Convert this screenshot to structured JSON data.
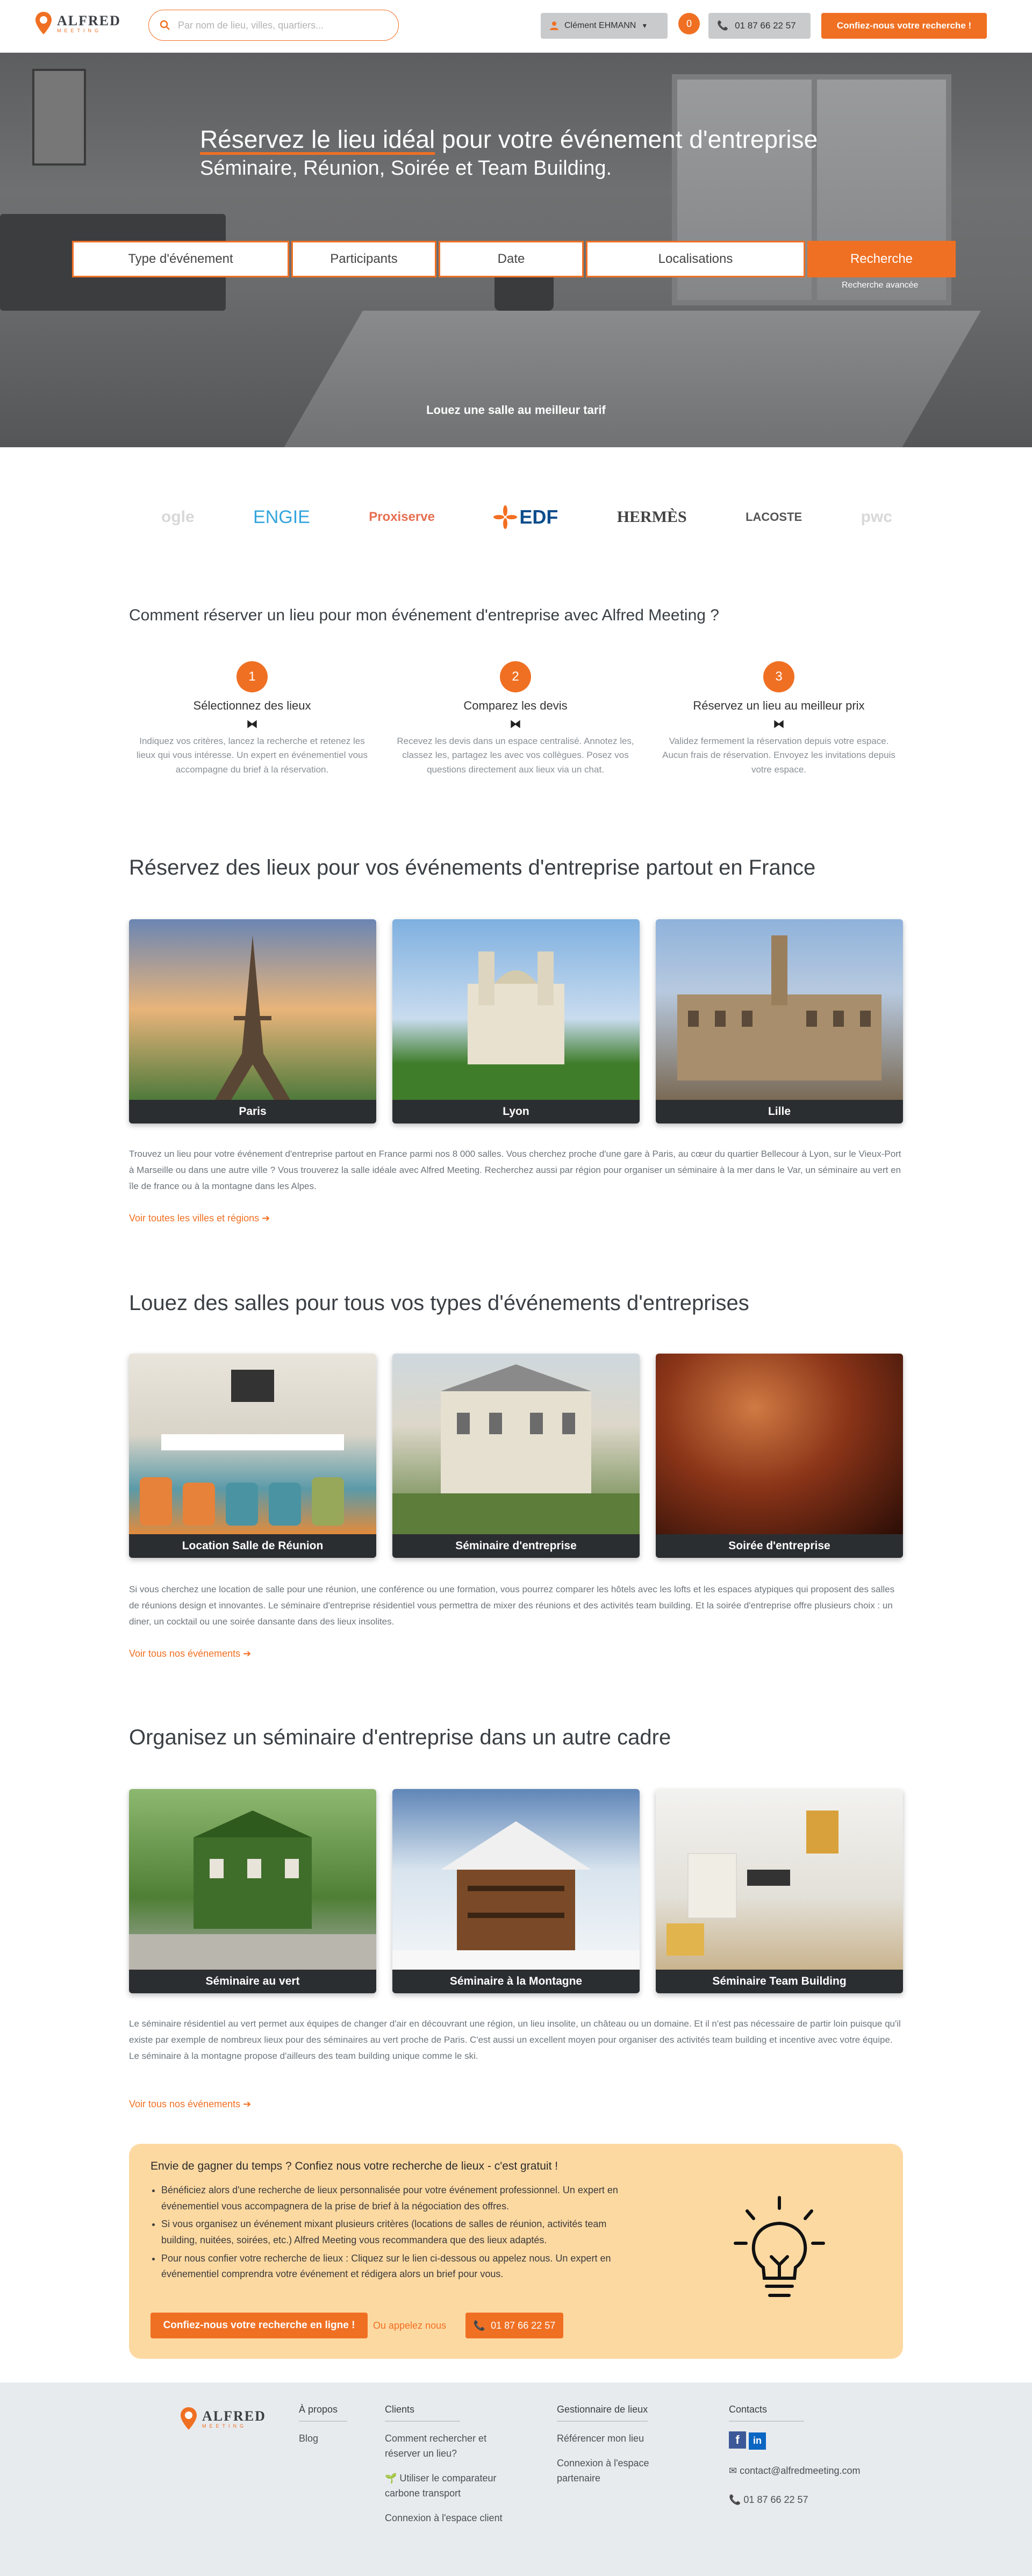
{
  "header": {
    "logo_name": "ALFRED",
    "logo_sub": "MEETING",
    "search_placeholder": "Par nom de lieu, villes, quartiers...",
    "user_name": "Clément EHMANN",
    "notifications": "0",
    "phone": "01 87 66 22 57",
    "cta": "Confiez-nous votre recherche !"
  },
  "hero": {
    "title_highlight": "Réservez le lieu idéal",
    "title_rest": " pour votre événement d'entreprise",
    "subtitle": "Séminaire, Réunion, Soirée et Team Building.",
    "fields": [
      "Type d'événement",
      "Participants",
      "Date",
      "Localisations"
    ],
    "search_button": "Recherche",
    "advanced": "Recherche avancée",
    "tagline": "Louez une salle au meilleur tarif"
  },
  "logos": [
    "ogle",
    "ENGIE",
    "Proxiserve",
    "EDF",
    "HERMÈS",
    "LACOSTE",
    "pwc"
  ],
  "how": {
    "title": "Comment réserver un lieu pour mon événement d'entreprise avec Alfred Meeting ?",
    "steps": [
      {
        "num": "1",
        "title": "Sélectionnez des lieux",
        "desc": "Indiquez vos critères, lancez la recherche et retenez les lieux qui vous intéresse. Un expert en événementiel vous accompagne du brief à la réservation."
      },
      {
        "num": "2",
        "title": "Comparez les devis",
        "desc": "Recevez les devis dans un espace centralisé. Annotez les, classez les, partagez les avec vos collègues. Posez vos questions directement aux lieux via un chat."
      },
      {
        "num": "3",
        "title": "Réservez un lieu au meilleur prix",
        "desc": "Validez fermement la réservation depuis votre espace. Aucun frais de réservation. Envoyez les invitations depuis votre espace."
      }
    ]
  },
  "sections": {
    "cities": {
      "title": "Réservez des lieux pour vos événements d'entreprise partout en France",
      "cards": [
        "Paris",
        "Lyon",
        "Lille"
      ],
      "text": "Trouvez un lieu pour votre événement d'entreprise partout en France parmi nos 8 000 salles. Vous cherchez proche d'une gare à Paris, au cœur du quartier Bellecour à Lyon, sur le Vieux-Port à Marseille ou dans une autre ville ? Vous trouverez la salle idéale avec Alfred Meeting. Recherchez aussi par région pour organiser un séminaire à la mer dans le Var, un séminaire au vert en île de france ou à la montagne dans les Alpes.",
      "link": "Voir toutes les villes et régions ➔"
    },
    "types": {
      "title": "Louez des salles pour tous vos types d'événements d'entreprises",
      "cards": [
        "Location Salle de Réunion",
        "Séminaire d'entreprise",
        "Soirée d'entreprise"
      ],
      "text": "Si vous cherchez une location de salle pour une réunion, une conférence ou une formation, vous pourrez comparer les hôtels avec les lofts et les espaces atypiques qui proposent des salles de réunions design et innovantes. Le séminaire d'entreprise résidentiel vous permettra de mixer des réunions et des activités team building. Et la soirée d'entreprise offre plusieurs choix : un diner, un cocktail ou une soirée dansante dans des lieux insolites.",
      "link": "Voir tous nos événements ➔"
    },
    "cadre": {
      "title": "Organisez un séminaire d'entreprise dans un autre cadre",
      "cards": [
        "Séminaire au vert",
        "Séminaire à la Montagne",
        "Séminaire Team Building"
      ],
      "text": "Le séminaire résidentiel au vert permet aux équipes de changer d'air en découvrant une région, un lieu insolite, un château ou un domaine. Et il n'est pas nécessaire de partir loin puisque qu'il existe par exemple de nombreux lieux pour des séminaires au vert proche de Paris. C'est aussi un excellent moyen pour organiser des activités team building et incentive avec votre équipe. Le séminaire à la montagne propose d'ailleurs des team building unique comme le ski.",
      "link": "Voir tous nos événements ➔"
    }
  },
  "banner": {
    "title": "Envie de gagner du temps ? Confiez nous votre recherche de lieux - c'est gratuit !",
    "bullets": [
      "Bénéficiez alors d'une recherche de lieux personnalisée pour votre événement professionnel. Un expert en événementiel vous accompagnera de la prise de brief à la négociation des offres.",
      "Si vous organisez un événement mixant plusieurs critères (locations de salles de réunion, activités team building, nuitées, soirées, etc.) Alfred Meeting vous recommandera que des lieux adaptés.",
      "Pour nous confier votre recherche de lieux : Cliquez sur le lien ci-dessous ou appelez nous. Un expert en événementiel comprendra votre événement et rédigera alors un brief pour vous."
    ],
    "cta": "Confiez-nous votre recherche en ligne !",
    "or": "Ou appelez nous",
    "phone": "01 87 66 22 57"
  },
  "footer": {
    "about": {
      "head": "À propos",
      "links": [
        "Blog"
      ]
    },
    "clients": {
      "head": "Clients",
      "links": [
        "Comment rechercher et réserver un lieu?",
        "Utiliser le comparateur carbone transport",
        "Connexion à l'espace client"
      ]
    },
    "managers": {
      "head": "Gestionnaire de lieux",
      "links": [
        "Référencer mon lieu",
        "Connexion à l'espace partenaire"
      ]
    },
    "contacts": {
      "head": "Contacts",
      "email": "contact@alfredmeeting.com",
      "phone": "01 87 66 22 57"
    }
  },
  "colors": {
    "accent": "#f07023",
    "banner": "#fdd9a2",
    "footer": "#e8ebee"
  }
}
